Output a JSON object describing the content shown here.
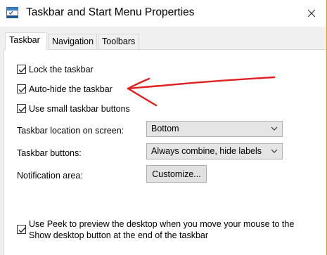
{
  "window": {
    "title": "Taskbar and Start Menu Properties",
    "accent_border": "#d4a017"
  },
  "tabs": [
    {
      "label": "Taskbar",
      "active": true
    },
    {
      "label": "Navigation",
      "active": false
    },
    {
      "label": "Toolbars",
      "active": false
    }
  ],
  "taskbar": {
    "lock": {
      "label": "Lock the taskbar",
      "checked": true
    },
    "autohide": {
      "label": "Auto-hide the taskbar",
      "checked": true
    },
    "small_buttons": {
      "label": "Use small taskbar buttons",
      "checked": true
    },
    "location": {
      "label": "Taskbar location on screen:",
      "value": "Bottom"
    },
    "buttons": {
      "label": "Taskbar buttons:",
      "value": "Always combine, hide labels"
    },
    "notification": {
      "label": "Notification area:",
      "button_label": "Customize..."
    },
    "peek": {
      "line1": "Use Peek to preview the desktop when you move your mouse to the",
      "line2": "Show desktop button at the end of the taskbar",
      "checked": true
    }
  },
  "annotation": {
    "color": "#e02020",
    "shape": "hand-drawn-arrow"
  },
  "icons": [
    "app-icon",
    "close-icon",
    "checkmark-icon",
    "chevron-down-icon"
  ]
}
